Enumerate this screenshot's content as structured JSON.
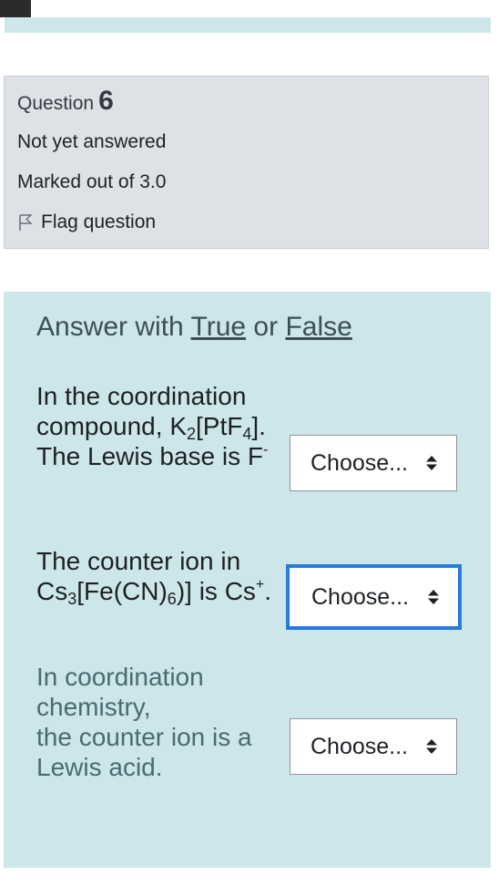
{
  "info": {
    "question_word": "Question",
    "question_number": "6",
    "state": "Not yet answered",
    "grade": "Marked out of 3.0",
    "flag_label": "Flag question"
  },
  "content": {
    "prompt_pre": "Answer with ",
    "prompt_true": "True",
    "prompt_mid": " or ",
    "prompt_false": "False",
    "items": [
      {
        "stem_line1": "In the coordination compound,",
        "formula": "K2[PtF4]",
        "stem_tail": ". The Lewis base is F",
        "superscript": "-",
        "select_value": "Choose..."
      },
      {
        "stem_pre": "The counter ion in",
        "formula": "Cs3[Fe(CN)6)]",
        "stem_tail": " is Cs",
        "superscript": "+",
        "stem_end": ".",
        "select_value": "Choose..."
      },
      {
        "stem_line1": "In coordination chemistry,",
        "stem_line2": "the counter ion is a Lewis acid.",
        "select_value": "Choose..."
      }
    ]
  },
  "colors": {
    "panel_bg": "#cde6ea",
    "info_bg": "#dee2e6",
    "focus_border": "#2a7ad9"
  }
}
